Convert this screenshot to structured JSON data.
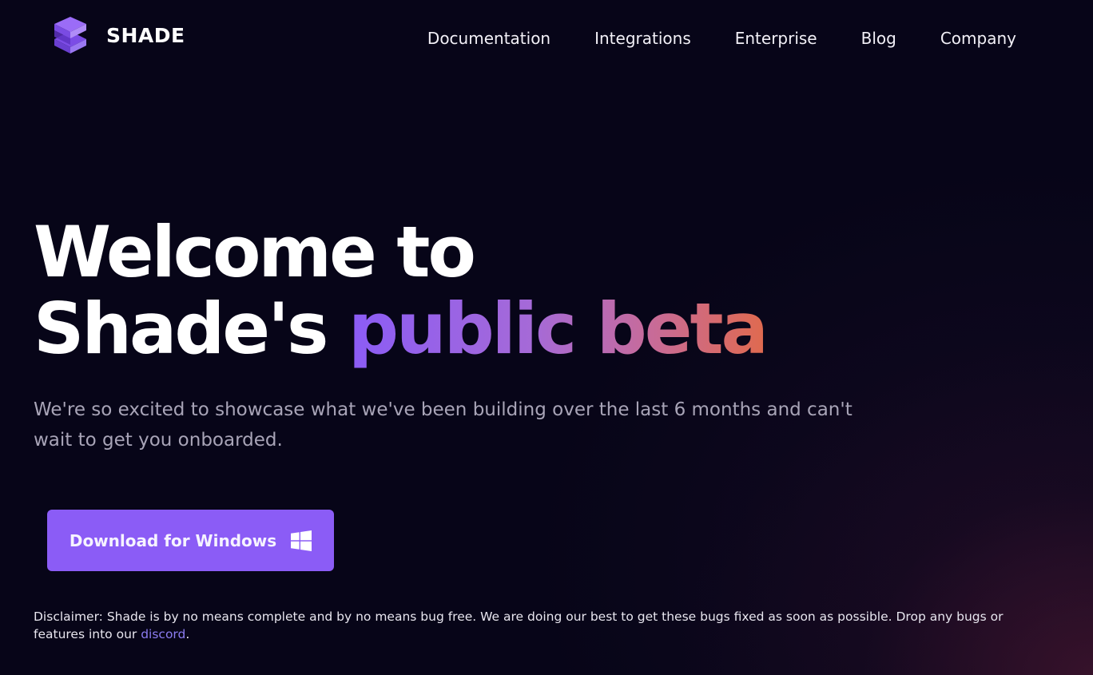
{
  "header": {
    "brand_name": "SHADE",
    "logo_icon": "stacked-layers-cube-icon",
    "nav": [
      {
        "label": "Documentation"
      },
      {
        "label": "Integrations"
      },
      {
        "label": "Enterprise"
      },
      {
        "label": "Blog"
      },
      {
        "label": "Company"
      }
    ]
  },
  "hero": {
    "title_line1": "Welcome to",
    "title_line2_plain": "Shade's",
    "title_line2_accent": "public beta",
    "subtitle": "We're so excited to showcase what we've been building over the last 6 months and can't wait to get you onboarded."
  },
  "download": {
    "label": "Download for Windows",
    "icon": "windows-logo-icon"
  },
  "disclaimer": {
    "text": "Disclaimer: Shade is by no means complete and by no means bug free. We are doing our best to get these bugs fixed as soon as possible. Drop any bugs or features into our",
    "link_label": "discord",
    "suffix": "."
  },
  "colors": {
    "background": "#070518",
    "accent": "#8b5cf6",
    "gradient_start": "#8b5cf6",
    "gradient_end": "#e06a4e",
    "link": "#8b7cf0",
    "subtitle": "#a8a4b7"
  }
}
